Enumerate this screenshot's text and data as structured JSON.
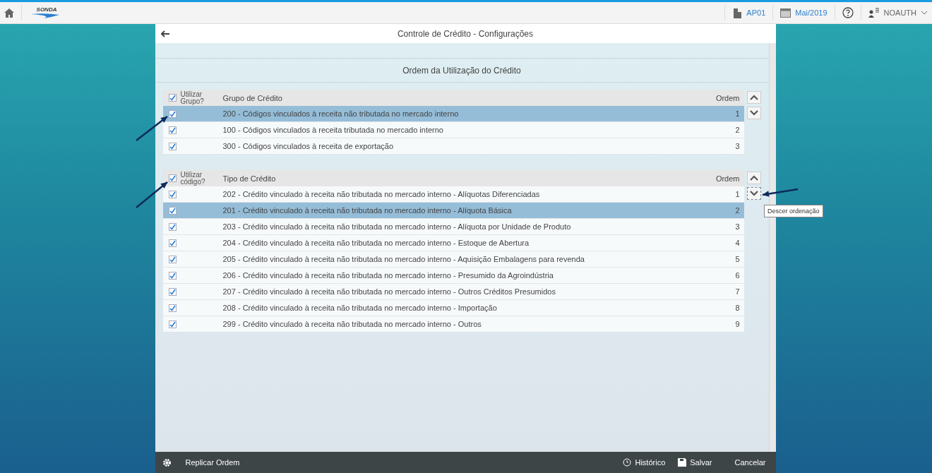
{
  "topbar": {
    "logo": "SONDA",
    "company": "AP01",
    "period": "Mai/2019",
    "user": "NOAUTH"
  },
  "panel": {
    "title": "Controle de Crédito - Configurações",
    "section_title": "Ordem da Utilização do Crédito"
  },
  "tables": [
    {
      "use_label": "Utilizar Grupo?",
      "use_checked": true,
      "column_title": "Grupo de Crédito",
      "order_title": "Ordem",
      "rows": [
        {
          "checked": true,
          "selected": true,
          "label": "200 - Códigos vinculados à receita não tributada no mercado interno",
          "order": "1"
        },
        {
          "checked": true,
          "selected": false,
          "label": "100 - Códigos vinculados à receita tributada no mercado interno",
          "order": "2"
        },
        {
          "checked": true,
          "selected": false,
          "label": "300 - Códigos vinculados à receita de exportação",
          "order": "3"
        }
      ]
    },
    {
      "use_label": "Utilizar código?",
      "use_checked": true,
      "column_title": "Tipo de Crédito",
      "order_title": "Ordem",
      "rows": [
        {
          "checked": true,
          "selected": false,
          "label": "202 - Crédito vinculado à receita não tributada no mercado interno - Alíquotas Diferenciadas",
          "order": "1"
        },
        {
          "checked": true,
          "selected": true,
          "label": "201 - Crédito vinculado à receita não tributada no mercado interno - Alíquota Básica",
          "order": "2"
        },
        {
          "checked": true,
          "selected": false,
          "label": "203 - Crédito vinculado à receita não tributada no mercado interno - Alíquota por Unidade de Produto",
          "order": "3"
        },
        {
          "checked": true,
          "selected": false,
          "label": "204 - Crédito vinculado à receita não tributada no mercado interno - Estoque de Abertura",
          "order": "4"
        },
        {
          "checked": true,
          "selected": false,
          "label": "205 - Crédito vinculado à receita não tributada no mercado interno - Aquisição Embalagens para revenda",
          "order": "5"
        },
        {
          "checked": true,
          "selected": false,
          "label": "206 - Crédito vinculado à receita não tributada no mercado interno - Presumido da Agroindústria",
          "order": "6"
        },
        {
          "checked": true,
          "selected": false,
          "label": "207 - Crédito vinculado à receita não tributada no mercado interno - Outros Créditos Presumidos",
          "order": "7"
        },
        {
          "checked": true,
          "selected": false,
          "label": "208 - Crédito vinculado à receita não tributada no mercado interno - Importação",
          "order": "8"
        },
        {
          "checked": true,
          "selected": false,
          "label": "299 - Crédito vinculado à receita não tributada no mercado interno - Outros",
          "order": "9"
        }
      ]
    }
  ],
  "tooltip": "Descer ordenação",
  "footer": {
    "replicate": "Replicar Ordem",
    "history": "Histórico",
    "save": "Salvar",
    "cancel": "Cancelar"
  }
}
